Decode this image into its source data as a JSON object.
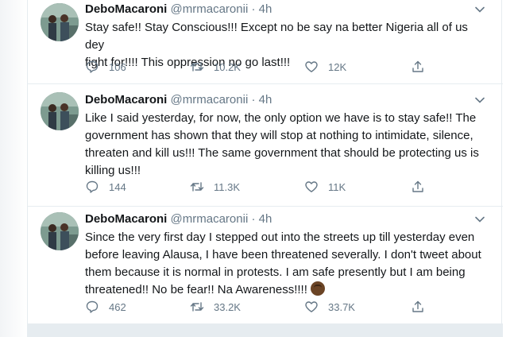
{
  "tweets": [
    {
      "author": "DeboMacaroni",
      "handle": "@mrmacaronii",
      "dot": "·",
      "time": "4h",
      "text_lines": [
        "Stay safe!! Stay Conscious!!! Except no be say na better Nigeria all of us dey",
        "fight for!!!! This oppression no go last!!!"
      ],
      "replies": "106",
      "retweets": "10.2K",
      "likes": "12K"
    },
    {
      "author": "DeboMacaroni",
      "handle": "@mrmacaronii",
      "dot": "·",
      "time": "4h",
      "text_lines": [
        "Like I said yesterday, for now, the only option we have is to stay safe!! The",
        "government has shown that they will stop at nothing to intimidate, silence,",
        "threaten and kill us!!! The same government that should be protecting us is",
        "killing us!!!"
      ],
      "replies": "144",
      "retweets": "11.3K",
      "likes": "11K"
    },
    {
      "author": "DeboMacaroni",
      "handle": "@mrmacaronii",
      "dot": "·",
      "time": "4h",
      "text_lines": [
        "Since the very first day I stepped out into the streets up till yesterday even",
        "before leaving Alausa, I have been threatened severally. I don't tweet about",
        "them because it is normal in protests. I am safe presently but I am being",
        "threatened!! No be fear!! Na Awareness!!!!"
      ],
      "emoji": "raised-fist-emoji",
      "replies": "462",
      "retweets": "33.2K",
      "likes": "33.7K"
    }
  ],
  "icons": {
    "reply": "reply-icon",
    "retweet": "retweet-icon",
    "like": "heart-icon",
    "share": "share-icon",
    "caret": "chevron-down-icon"
  },
  "colors": {
    "text": "#14171a",
    "secondary": "#657786",
    "border": "#e6ecf0"
  }
}
